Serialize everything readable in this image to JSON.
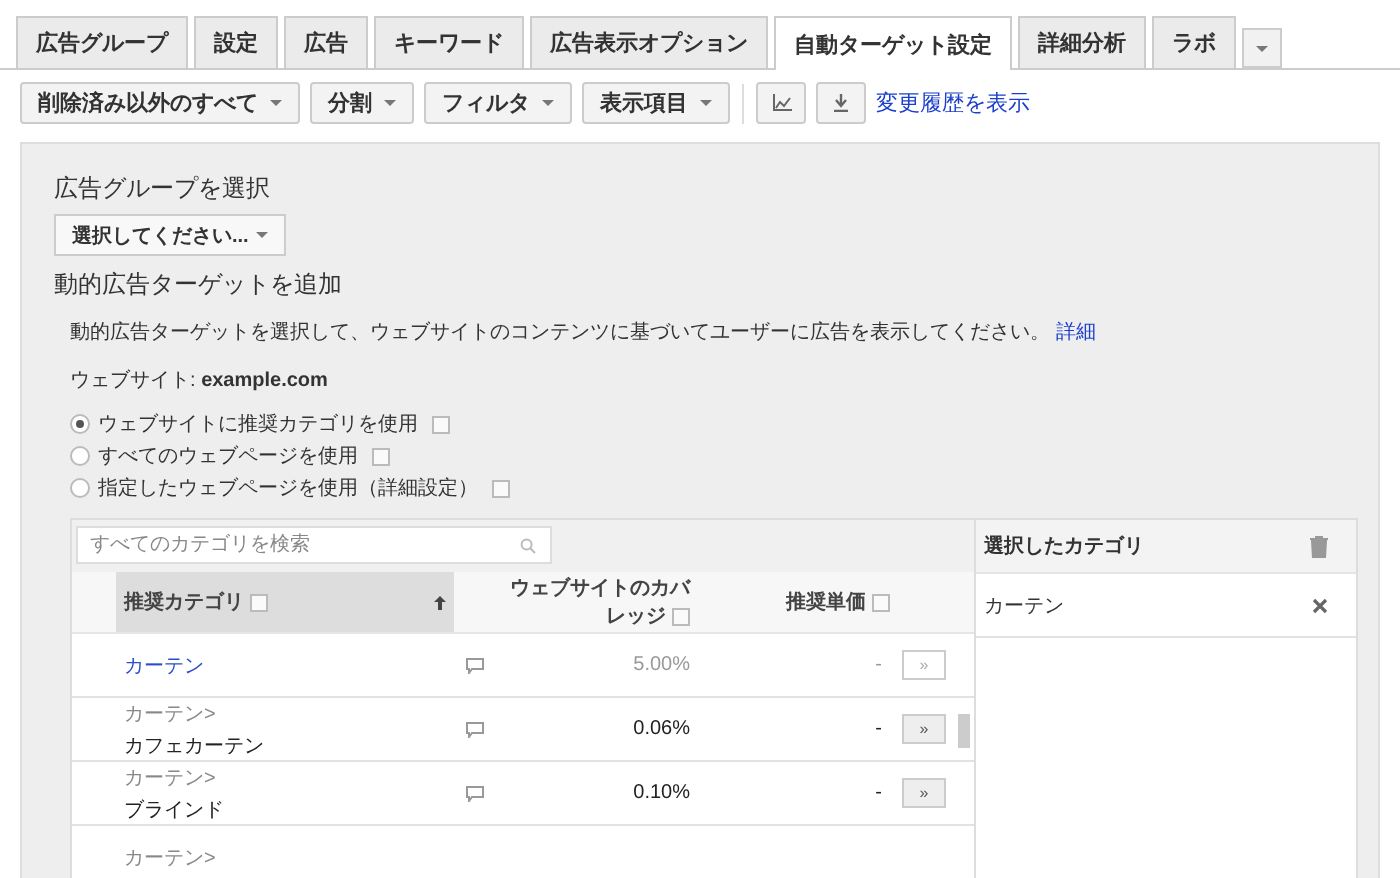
{
  "tabs": [
    {
      "label": "広告グループ",
      "selected": false
    },
    {
      "label": "設定",
      "selected": false
    },
    {
      "label": "広告",
      "selected": false
    },
    {
      "label": "キーワード",
      "selected": false
    },
    {
      "label": "広告表示オプション",
      "selected": false
    },
    {
      "label": "自動ターゲット設定",
      "selected": true
    },
    {
      "label": "詳細分析",
      "selected": false
    },
    {
      "label": "ラボ",
      "selected": false
    }
  ],
  "toolbar": [
    {
      "kind": "dropdown",
      "label": "削除済み以外のすべて"
    },
    {
      "kind": "dropdown",
      "label": "分割"
    },
    {
      "kind": "dropdown",
      "label": "フィルタ"
    },
    {
      "kind": "dropdown",
      "label": "表示項目"
    },
    {
      "kind": "chart"
    },
    {
      "kind": "download"
    },
    {
      "kind": "link",
      "label": "変更履歴を表示"
    }
  ],
  "panel": {
    "ad_group_heading": "広告グループを選択",
    "ad_group_select": {
      "value": "選択してください..."
    },
    "add_heading": "動的広告ターゲットを追加",
    "description": "動的広告ターゲットを選択して、ウェブサイトのコンテンツに基づいてユーザーに広告を表示してください。",
    "description_link": "詳細",
    "website": "ウェブサイト: **example.com**",
    "options": [
      {
        "label": "ウェブサイトに推奨カテゴリを使用",
        "selected": true
      },
      {
        "label": "すべてのウェブページを使用",
        "selected": false
      },
      {
        "label": "指定したウェブページを使用（詳細設定）",
        "selected": false
      }
    ]
  },
  "category_table": {
    "search": {
      "placeholder": "すべてのカテゴリを検索"
    },
    "columns": [
      {
        "label": "推奨カテゴリ",
        "sorted": true
      },
      {
        "label": "ウェブサイトのカバレッジ",
        "sorted": false
      },
      {
        "label": "推奨単価",
        "sorted": false
      }
    ],
    "rows": [
      {
        "name": "カーテン",
        "coverage": "5.00%",
        "price": "-",
        "button": "»",
        "added": true
      },
      {
        "parent": "カーテン>",
        "name": "カフェカーテン",
        "coverage": "0.06%",
        "price": "-",
        "button": "»",
        "added": false
      },
      {
        "parent": "カーテン>",
        "name": "ブラインド",
        "coverage": "0.10%",
        "price": "-",
        "button": "»",
        "added": false
      },
      {
        "parent": "カーテン>"
      }
    ]
  },
  "selected_panel": {
    "title": "選択したカテゴリ",
    "items": [
      {
        "label": "カーテン"
      }
    ]
  }
}
